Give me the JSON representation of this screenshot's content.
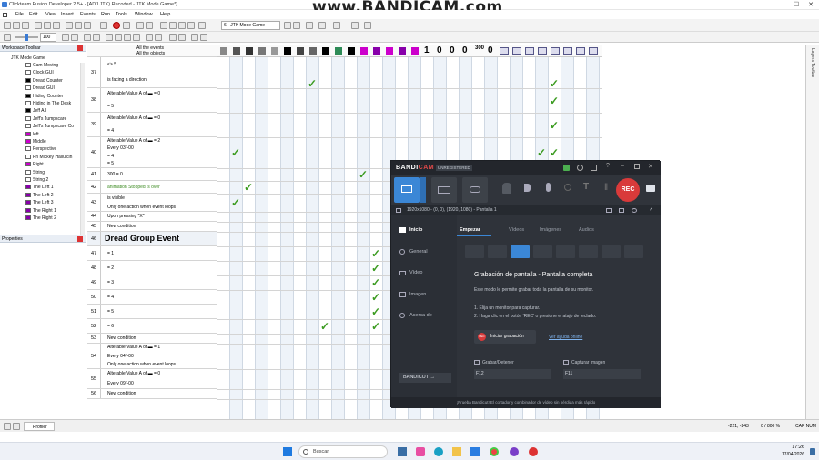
{
  "window": {
    "title": "Clickteam Fusion Developer 2.5+ - [ADJ JTK) Recoded - JTK Mode Game*]",
    "minimize": "—",
    "maximize": "☐",
    "close": "✕"
  },
  "watermark": "www.BANDICAM.com",
  "menu": [
    "File",
    "Edit",
    "View",
    "Insert",
    "Events",
    "Run",
    "Tools",
    "Window",
    "Help"
  ],
  "toolbar": {
    "frame_select": "6 - JTK Mode Game",
    "zoom": "100"
  },
  "workspace": {
    "header": "Workspace Toolbar",
    "root": "JTK Mode Game",
    "items": [
      {
        "label": "Cam Moving",
        "color": "#ffffff"
      },
      {
        "label": "Clock GUI",
        "color": "#ffffff"
      },
      {
        "label": "Dread Counter",
        "color": "#000000"
      },
      {
        "label": "Dread GUI",
        "color": "#ffffff"
      },
      {
        "label": "Hiding Counter",
        "color": "#000000"
      },
      {
        "label": "Hiding in The Desk",
        "color": "#ffffff"
      },
      {
        "label": "Jeff A.I",
        "color": "#000000"
      },
      {
        "label": "Jeff's Jumpscare",
        "color": "#ffffff"
      },
      {
        "label": "Jeff's Jumpscare Co",
        "color": "#ffffff"
      },
      {
        "label": "left",
        "color": "#cc00cc"
      },
      {
        "label": "Middle",
        "color": "#cc00cc"
      },
      {
        "label": "Perspective",
        "color": "#ffffff"
      },
      {
        "label": "Pn Mickey Halluicin",
        "color": "#ffffff"
      },
      {
        "label": "Right",
        "color": "#cc00cc"
      },
      {
        "label": "String",
        "color": "#ffffff"
      },
      {
        "label": "String 2",
        "color": "#ffffff"
      },
      {
        "label": "The Left 1",
        "color": "#8800aa"
      },
      {
        "label": "The Left 2",
        "color": "#8800aa"
      },
      {
        "label": "The Left 3",
        "color": "#8800aa"
      },
      {
        "label": "The Right 1",
        "color": "#8800aa"
      },
      {
        "label": "The Right 2",
        "color": "#8800aa"
      }
    ],
    "properties_header": "Properties"
  },
  "events": {
    "header_all_events": "All the events",
    "header_all_objects": "All the objects",
    "rows": [
      {
        "num": "37",
        "lines": [
          "<> 5",
          "is facing a direction"
        ]
      },
      {
        "num": "38",
        "lines": [
          "Alterable Value A of ▬ = 0",
          "= 5"
        ]
      },
      {
        "num": "39",
        "lines": [
          "Alterable Value A of ▬ = 0",
          "= 4"
        ]
      },
      {
        "num": "40",
        "lines": [
          "Alterable Value A of ▬ = 2",
          "Every 03\"-00",
          "= 4",
          "= 5"
        ]
      },
      {
        "num": "41",
        "lines": [
          "300 = 0"
        ]
      },
      {
        "num": "42",
        "lines": [
          "animation Stopped is over"
        ]
      },
      {
        "num": "43",
        "lines": [
          "is visible",
          "Only one action when event loops"
        ]
      },
      {
        "num": "44",
        "lines": [
          "Upon pressing \"X\""
        ]
      },
      {
        "num": "45",
        "lines": [
          "New condition"
        ]
      },
      {
        "num": "46",
        "lines": [
          "Dread Group Event"
        ]
      },
      {
        "num": "47",
        "lines": [
          "= 1"
        ]
      },
      {
        "num": "48",
        "lines": [
          "= 2"
        ]
      },
      {
        "num": "49",
        "lines": [
          "= 3"
        ]
      },
      {
        "num": "50",
        "lines": [
          "= 4"
        ]
      },
      {
        "num": "51",
        "lines": [
          "= 5"
        ]
      },
      {
        "num": "52",
        "lines": [
          "= 6"
        ]
      },
      {
        "num": "53",
        "lines": [
          "New condition"
        ]
      },
      {
        "num": "54",
        "lines": [
          "Alterable Value A of ▬ = 1",
          "Every 04\"-00",
          "Only one action when event loops"
        ]
      },
      {
        "num": "55",
        "lines": [
          "Alterable Value A of ▬ = 0",
          "Every 09\"-00"
        ]
      },
      {
        "num": "56",
        "lines": [
          "New condition"
        ]
      }
    ]
  },
  "counters": [
    "1",
    "0",
    "0",
    "0",
    "300",
    "0"
  ],
  "layers_toolbar": "Layers Toolbar",
  "statusbar": {
    "profiler": "Profiler",
    "coords": "-221, -243",
    "zoom": "0 / 800 %",
    "mode": "CAP NUM"
  },
  "taskbar": {
    "search_placeholder": "Buscar",
    "time": "17:26",
    "date": "17/04/2026"
  },
  "bandicam": {
    "logo_a": "BANDI",
    "logo_b": "CAM",
    "unregistered": "UNREGISTERED",
    "rec": "REC",
    "resolution": "1920x1080 - (0, 0), (1920, 1080) - Pantalla 1",
    "sidebar": [
      "Inicio",
      "General",
      "Vídeo",
      "Imagen",
      "Acerca de"
    ],
    "tabs": [
      "Empezar",
      "Vídeos",
      "Imágenes",
      "Audios"
    ],
    "heading": "Grabación de pantalla - Pantalla completa",
    "desc": "Este modo le permite grabar toda la pantalla de su monitor.",
    "step1": "1. Elija un monitor para capturar.",
    "step2": "2. Haga clic en el botón 'REC' o presione el atajo de teclado.",
    "start_button": "Iniciar grabación",
    "help_link": "Ver ayuda online",
    "record_stop_label": "Grabar/Detener",
    "record_stop_key": "F12",
    "capture_label": "Capturar imagen",
    "capture_key": "F11",
    "bandicut": "BANDICUT →",
    "footer": "¡Prueba Bandicut! El cortador y combinador de vídeo sin pérdida más rápido"
  },
  "colors": {
    "check": "#3b9b20",
    "bandicam_bg": "#2b2f36",
    "bandicam_accent": "#3b87d6",
    "rec_red": "#d93a3a"
  }
}
